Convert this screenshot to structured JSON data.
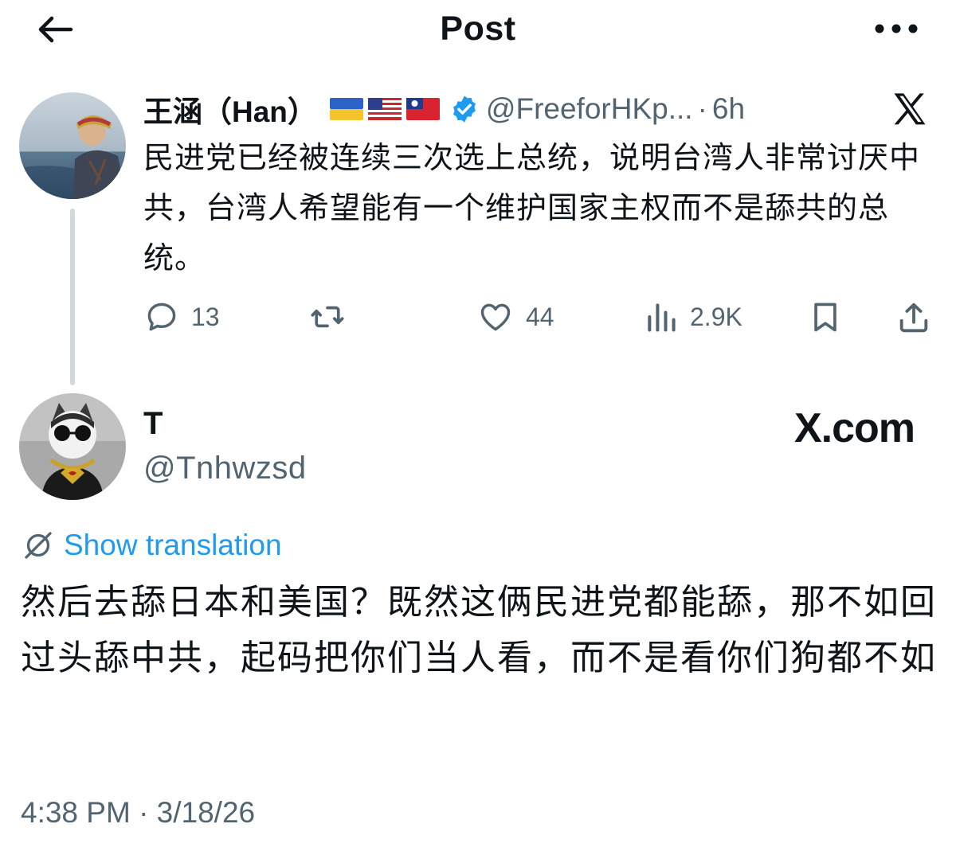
{
  "header": {
    "title": "Post",
    "back_icon": "arrow-left-icon",
    "more_icon": "more-horizontal-icon"
  },
  "parent_post": {
    "display_name": "王涵（Han）",
    "flags": [
      "ukraine-flag-icon",
      "usa-flag-icon",
      "taiwan-flag-icon"
    ],
    "verified_icon": "verified-badge-icon",
    "handle": "@FreeforHKp...",
    "separator": "·",
    "time_ago": "6h",
    "text": "民进党已经被连续三次选上总统，说明台湾人非常讨厌中共，台湾人希望能有一个维护国家主权而不是舔共的总统。",
    "actions": {
      "replies": "13",
      "reposts": "",
      "likes": "44",
      "views": "2.9K"
    }
  },
  "reply_post": {
    "display_name": "T",
    "handle": "@Tnhwzsd",
    "brand": "X.com",
    "translation_link": "Show translation",
    "text": "然后去舔日本和美国？既然这俩民进党都能舔，那不如回过头舔中共，起码把你们当人看，而不是看你们狗都不如",
    "timestamp": "4:38 PM · 3/18/26"
  },
  "colors": {
    "text_primary": "#0f1419",
    "text_secondary": "#536471",
    "link_blue": "#1d9bf0",
    "thread_line": "#cfd9de"
  }
}
